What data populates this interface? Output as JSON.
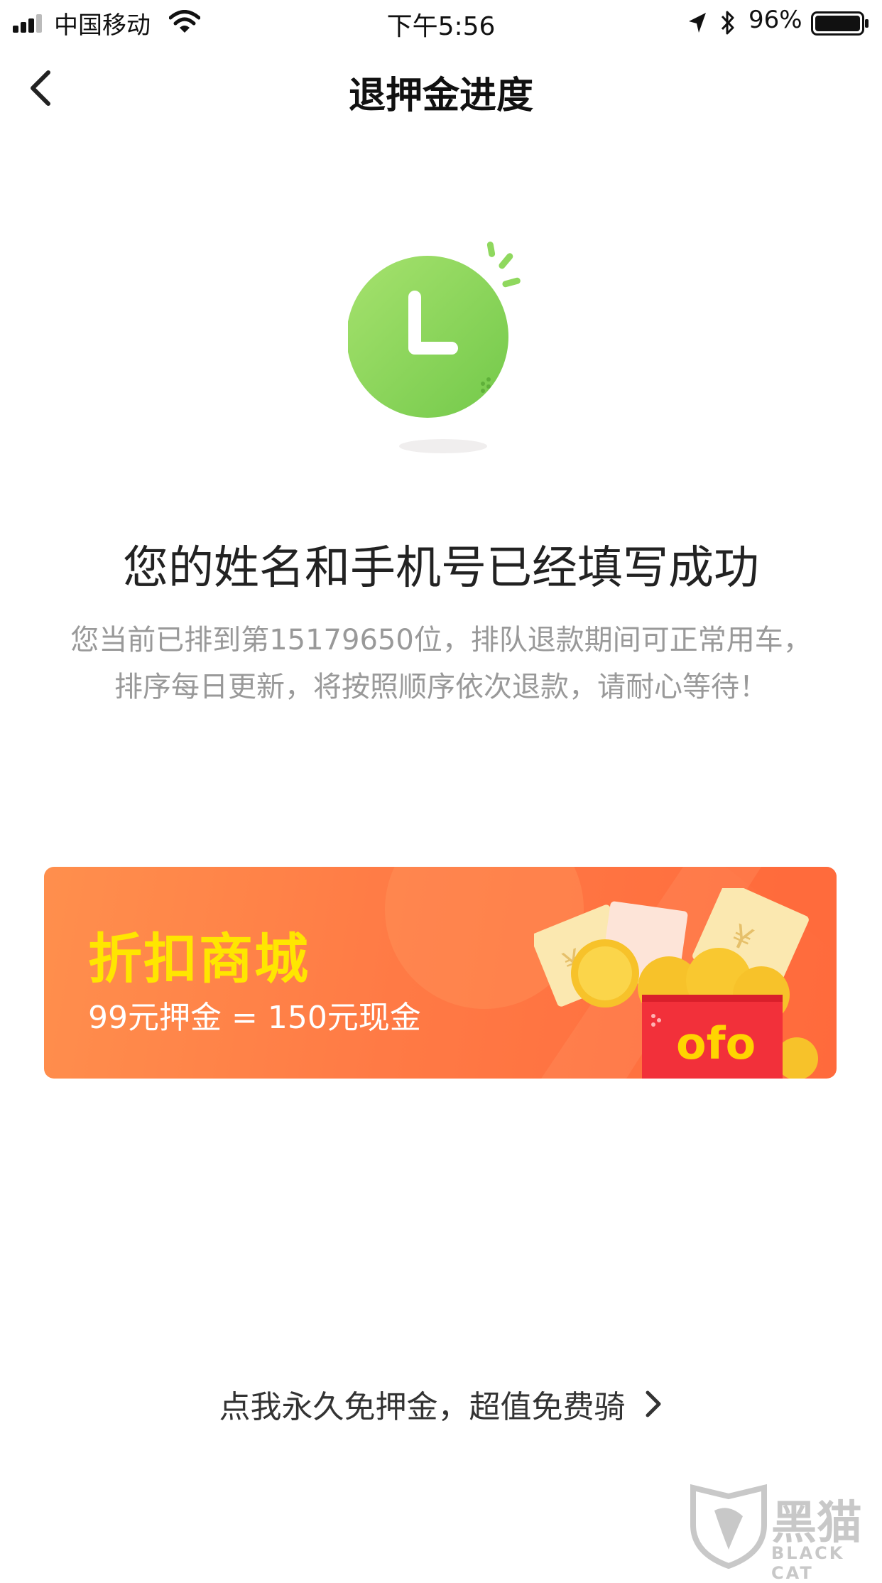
{
  "status_bar": {
    "carrier": "中国移动",
    "time": "下午5:56",
    "battery_percent": "96%",
    "icons": [
      "signal-icon",
      "wifi-icon",
      "location-icon",
      "bluetooth-icon",
      "battery-icon"
    ]
  },
  "nav": {
    "back_icon": "chevron-left-icon",
    "title": "退押金进度"
  },
  "illustration": {
    "icon": "clock-icon",
    "color": "#8fd85e"
  },
  "main": {
    "headline": "您的姓名和手机号已经填写成功",
    "description": "您当前已排到第15179650位，排队退款期间可正常用车，排序每日更新，将按照顺序依次退款，请耐心等待！"
  },
  "banner": {
    "title": "折扣商城",
    "subtitle": "99元押金 = 150元现金",
    "art_brand": "ofo",
    "title_color": "#ffe600",
    "background": "#ff7a45"
  },
  "cta": {
    "label": "点我永久免押金，超值免费骑",
    "icon": "chevron-right-icon"
  },
  "watermark": {
    "text": "黑猫",
    "subtext": "BLACK CAT"
  }
}
